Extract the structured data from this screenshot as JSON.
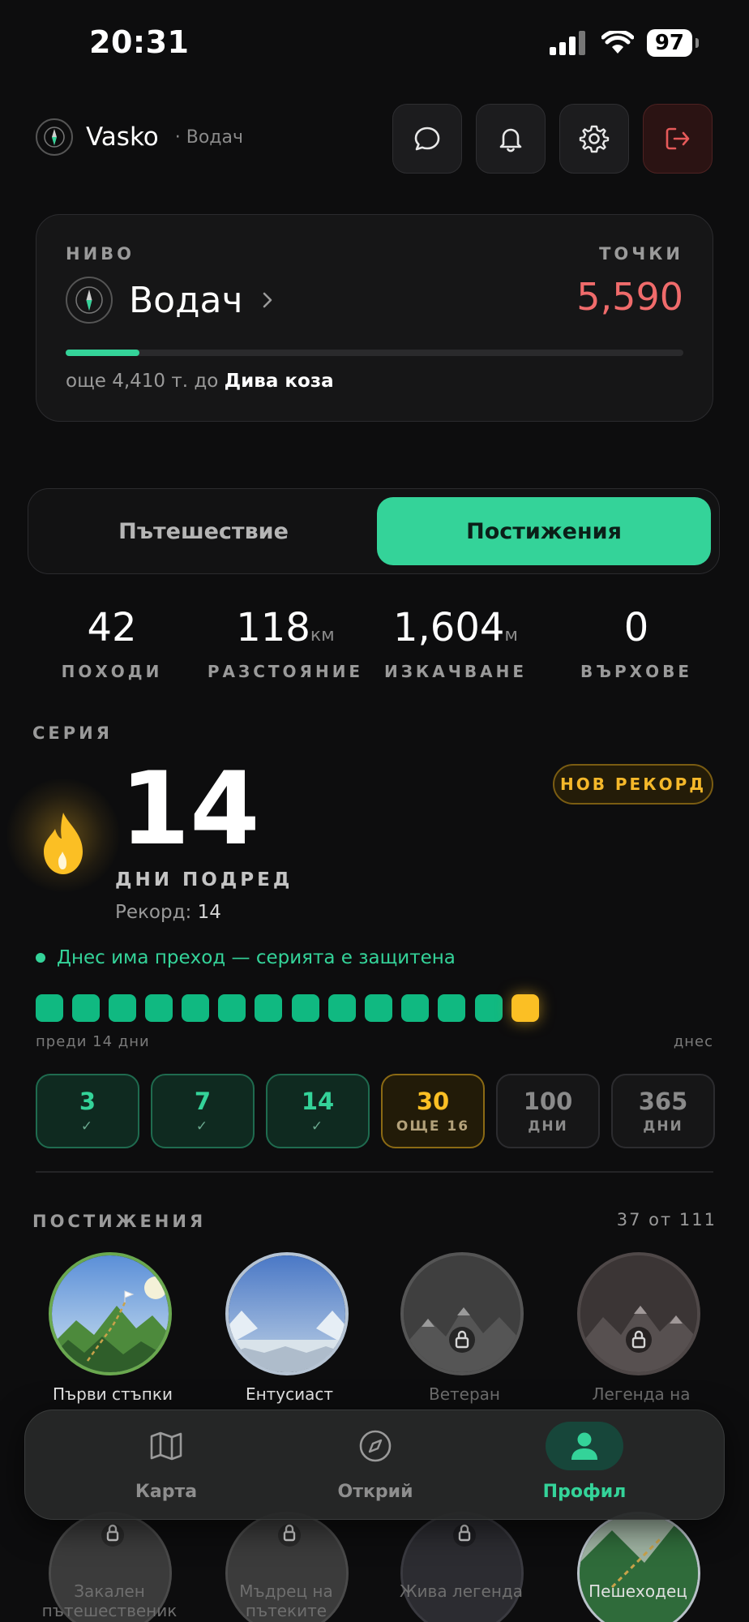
{
  "status_bar": {
    "time": "20:31",
    "battery": "97"
  },
  "header": {
    "user_name": "Vasko",
    "user_rank": "· Водач"
  },
  "level_card": {
    "level_label": "НИВО",
    "level_name": "Водач",
    "points_label": "ТОЧКИ",
    "points_value": "5,590",
    "progress_fraction": 0.12,
    "next_prefix": "още 4,410 т. до",
    "next_level": "Дива коза"
  },
  "tabs": {
    "journey": "Пътешествие",
    "achievements": "Постижения"
  },
  "stats": [
    {
      "value": "42",
      "unit": "",
      "label": "ПОХОДИ"
    },
    {
      "value": "118",
      "unit": "км",
      "label": "РАЗСТОЯНИЕ"
    },
    {
      "value": "1,604",
      "unit": "м",
      "label": "ИЗКАЧВАНЕ"
    },
    {
      "value": "0",
      "unit": "",
      "label": "ВЪРХОВЕ"
    }
  ],
  "streak": {
    "section_title": "СЕРИЯ",
    "days": "14",
    "record_badge": "НОВ РЕКОРД",
    "days_label": "ДНИ ПОДРЕД",
    "record_prefix": "Рекорд:",
    "record_value": "14",
    "protected_text": "Днес има преход — серията е защитена",
    "range_start": "преди 14 дни",
    "range_end": "днес",
    "milestones": [
      {
        "num": "3",
        "sub": "✓"
      },
      {
        "num": "7",
        "sub": "✓"
      },
      {
        "num": "14",
        "sub": "✓"
      },
      {
        "num": "30",
        "sub": "ОЩЕ 16"
      },
      {
        "num": "100",
        "sub": "ДНИ"
      },
      {
        "num": "365",
        "sub": "ДНИ"
      }
    ]
  },
  "achievements": {
    "section_title": "ПОСТИЖЕНИЯ",
    "count": "37 от 111",
    "badges": [
      {
        "name": "Първи стъпки"
      },
      {
        "name": "Ентусиаст"
      },
      {
        "name": "Ветеран"
      },
      {
        "name": "Легенда на"
      },
      {
        "name": "Закален пътешественик"
      },
      {
        "name": "Мъдрец на пътеките"
      },
      {
        "name": "Жива легенда"
      },
      {
        "name": "Пешеходец"
      }
    ]
  },
  "nav": {
    "map": "Карта",
    "discover": "Открий",
    "profile": "Профил"
  },
  "colors": {
    "accent": "#34d399",
    "points": "#f06b6b",
    "gold": "#fbbf24",
    "background": "#0d0d0e"
  }
}
